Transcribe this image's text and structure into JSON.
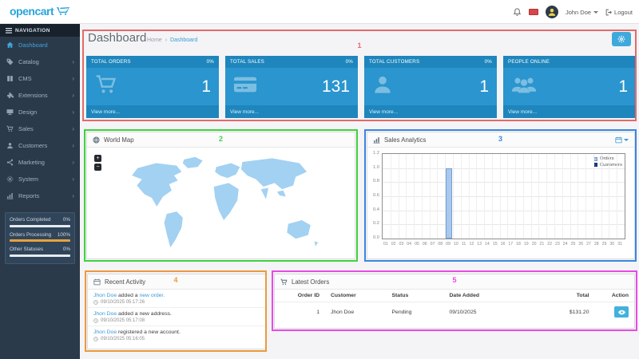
{
  "header": {
    "logo": "opencart",
    "user_name": "John Doe",
    "logout_label": "Logout"
  },
  "sidebar": {
    "nav_title": "NAVIGATION",
    "chevron": "›",
    "items": [
      {
        "label": "Dashboard",
        "icon": "home-icon",
        "active": true
      },
      {
        "label": "Catalog",
        "icon": "tag-icon"
      },
      {
        "label": "CMS",
        "icon": "book-icon"
      },
      {
        "label": "Extensions",
        "icon": "puzzle-icon"
      },
      {
        "label": "Design",
        "icon": "monitor-icon"
      },
      {
        "label": "Sales",
        "icon": "cart-icon"
      },
      {
        "label": "Customers",
        "icon": "user-icon"
      },
      {
        "label": "Marketing",
        "icon": "share-icon"
      },
      {
        "label": "System",
        "icon": "gear-icon"
      },
      {
        "label": "Reports",
        "icon": "bar-chart-icon"
      }
    ],
    "stats": [
      {
        "label": "Orders Completed",
        "value": "0%"
      },
      {
        "label": "Orders Processing",
        "value": "100%"
      },
      {
        "label": "Other Statuses",
        "value": "0%"
      }
    ]
  },
  "page": {
    "title": "Dashboard",
    "breadcrumb": {
      "home": "Home",
      "separator": "›",
      "current": "Dashboard"
    }
  },
  "tiles": [
    {
      "title": "TOTAL ORDERS",
      "percent": "0%",
      "value": "1",
      "icon": "cart-icon",
      "link": "View more..."
    },
    {
      "title": "TOTAL SALES",
      "percent": "0%",
      "value": "131",
      "icon": "credit-card-icon",
      "link": "View more..."
    },
    {
      "title": "TOTAL CUSTOMERS",
      "percent": "0%",
      "value": "1",
      "icon": "user-icon",
      "link": "View more..."
    },
    {
      "title": "PEOPLE ONLINE",
      "percent": "",
      "value": "1",
      "icon": "people-group-icon",
      "link": "View more..."
    }
  ],
  "world_map": {
    "title": "World Map",
    "zoom_in": "+",
    "zoom_out": "−"
  },
  "sales_analytics": {
    "title": "Sales Analytics"
  },
  "chart_data": {
    "type": "bar",
    "title": "Sales Analytics",
    "x": [
      "01",
      "02",
      "03",
      "04",
      "05",
      "06",
      "07",
      "08",
      "09",
      "10",
      "11",
      "12",
      "13",
      "14",
      "15",
      "16",
      "17",
      "18",
      "19",
      "20",
      "21",
      "22",
      "23",
      "24",
      "25",
      "26",
      "27",
      "28",
      "29",
      "30",
      "31"
    ],
    "series": [
      {
        "name": "Orders",
        "color": "#aac8ec",
        "border": "#6f9fd8",
        "values": [
          0,
          0,
          0,
          0,
          0,
          0,
          0,
          0,
          1,
          0,
          0,
          0,
          0,
          0,
          0,
          0,
          0,
          0,
          0,
          0,
          0,
          0,
          0,
          0,
          0,
          0,
          0,
          0,
          0,
          0,
          0
        ]
      },
      {
        "name": "Customers",
        "color": "#1b3e94",
        "border": "#142f70",
        "values": [
          0,
          0,
          0,
          0,
          0,
          0,
          0,
          0,
          0,
          0,
          0,
          0,
          0,
          0,
          0,
          0,
          0,
          0,
          0,
          0,
          0,
          0,
          0,
          0,
          0,
          0,
          0,
          0,
          0,
          0,
          0
        ]
      }
    ],
    "ylim": [
      0,
      1.2
    ],
    "yticks": [
      0.0,
      0.2,
      0.4,
      0.6,
      0.8,
      1.0,
      1.2
    ],
    "grid": true,
    "legend_position": "top-right",
    "xlabel": "",
    "ylabel": ""
  },
  "recent_activity": {
    "title": "Recent Activity",
    "items": [
      {
        "user": "Jhon Doe",
        "text": " added a ",
        "link": "new order.",
        "time": "09/10/2025 05:17:26"
      },
      {
        "user": "Jhon Doe",
        "text": " added a new address.",
        "link": "",
        "time": "09/10/2025 05:17:08"
      },
      {
        "user": "Jhon Doe",
        "text": " registered a new account.",
        "link": "",
        "time": "09/10/2025 05:16:05"
      }
    ]
  },
  "latest_orders": {
    "title": "Latest Orders",
    "columns": [
      "Order ID",
      "Customer",
      "Status",
      "Date Added",
      "Total",
      "Action"
    ],
    "rows": [
      {
        "order_id": "1",
        "customer": "Jhon Doe",
        "status": "Pending",
        "date_added": "09/10/2025",
        "total": "$131.20"
      }
    ]
  },
  "annotations": [
    {
      "number": "1",
      "color": "#e46a6a"
    },
    {
      "number": "2",
      "color": "#3fd23f"
    },
    {
      "number": "3",
      "color": "#3a86e0"
    },
    {
      "number": "4",
      "color": "#eb9a3d"
    },
    {
      "number": "5",
      "color": "#e84ae6"
    }
  ]
}
